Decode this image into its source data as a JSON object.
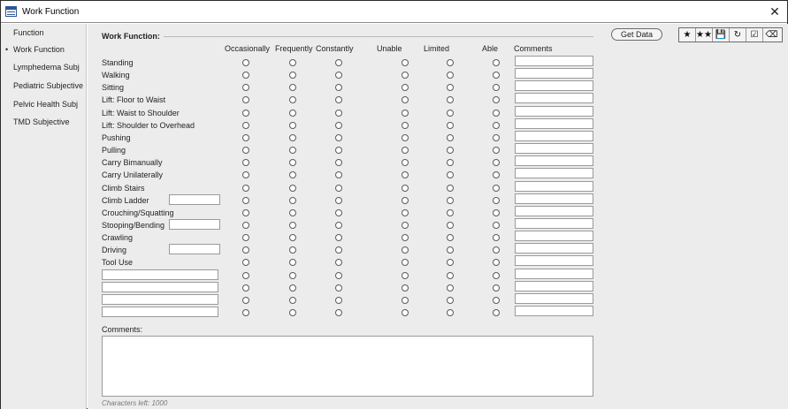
{
  "window": {
    "title": "Work Function",
    "close_glyph": "✕"
  },
  "sidebar": {
    "items": [
      {
        "label": "Function",
        "active": false
      },
      {
        "label": "Work Function",
        "active": true
      },
      {
        "label": "Lymphedema Subj",
        "active": false
      },
      {
        "label": "Pediatric Subjective",
        "active": false
      },
      {
        "label": "Pelvic Health Subj",
        "active": false
      },
      {
        "label": "TMD Subjective",
        "active": false
      }
    ],
    "active_bullet": "•"
  },
  "form": {
    "section_title": "Work Function:",
    "columns": [
      "Occasionally",
      "Frequently",
      "Constantly",
      "Unable",
      "Limited",
      "Able",
      "Comments"
    ],
    "rows": [
      {
        "label": "Standing",
        "has_input": false
      },
      {
        "label": "Walking",
        "has_input": false
      },
      {
        "label": "Sitting",
        "has_input": false
      },
      {
        "label": "Lift:  Floor to Waist",
        "has_input": false
      },
      {
        "label": "Lift:  Waist to Shoulder",
        "has_input": false
      },
      {
        "label": "Lift:  Shoulder to Overhead",
        "has_input": false
      },
      {
        "label": "Pushing",
        "has_input": false
      },
      {
        "label": "Pulling",
        "has_input": false
      },
      {
        "label": "Carry Bimanually",
        "has_input": false
      },
      {
        "label": "Carry Unilaterally",
        "has_input": false
      },
      {
        "label": "Climb Stairs",
        "has_input": false
      },
      {
        "label": "Climb Ladder",
        "has_input": true
      },
      {
        "label": "Crouching/Squatting",
        "has_input": false
      },
      {
        "label": "Stooping/Bending",
        "has_input": true
      },
      {
        "label": "Crawling",
        "has_input": false
      },
      {
        "label": "Driving",
        "has_input": true
      },
      {
        "label": "Tool Use",
        "has_input": false
      },
      {
        "label": "",
        "custom": true
      },
      {
        "label": "",
        "custom": true
      },
      {
        "label": "",
        "custom": true
      },
      {
        "label": "",
        "custom": true
      }
    ],
    "comments_label": "Comments:",
    "comments_value": "",
    "chars_left": "Characters left: 1000"
  },
  "actions": {
    "get_data_label": "Get Data",
    "toolbar": [
      {
        "name": "star-icon",
        "glyph": "★"
      },
      {
        "name": "double-star-icon",
        "glyph": "★★"
      },
      {
        "name": "save-icon",
        "glyph": "💾"
      },
      {
        "name": "refresh-icon",
        "glyph": "↻"
      },
      {
        "name": "checklist-icon",
        "glyph": "☑"
      },
      {
        "name": "eraser-icon",
        "glyph": "⌫"
      }
    ]
  }
}
